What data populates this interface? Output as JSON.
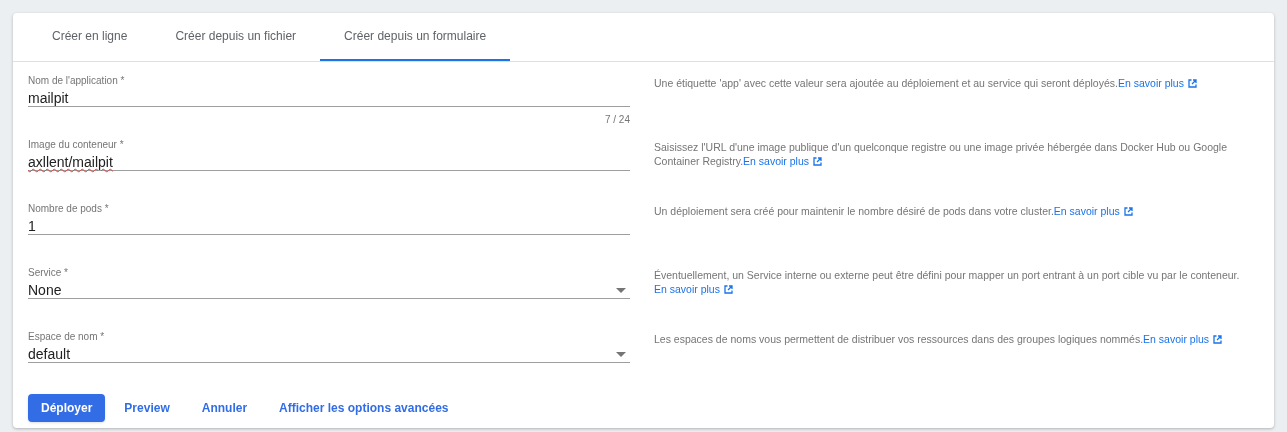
{
  "tabs": [
    {
      "label": "Créer en ligne",
      "selected": false
    },
    {
      "label": "Créer depuis un fichier",
      "selected": false
    },
    {
      "label": "Créer depuis un formulaire",
      "selected": true
    }
  ],
  "fields": [
    {
      "kind": "text",
      "label": "Nom de l'application *",
      "value": "mailpit",
      "counter": "7 / 24",
      "misspelled": false,
      "help": "Une étiquette 'app' avec cette valeur sera ajoutée au déploiement et au service qui seront déployés.",
      "link": "En savoir plus"
    },
    {
      "kind": "text",
      "label": "Image du conteneur *",
      "value": "axllent/mailpit",
      "misspelled": true,
      "help": "Saisissez l'URL d'une image publique d'un quelconque registre ou une image privée hébergée dans Docker Hub ou Google Container Registry.",
      "link": "En savoir plus"
    },
    {
      "kind": "text",
      "label": "Nombre de pods *",
      "value": "1",
      "misspelled": false,
      "help": "Un déploiement sera créé pour maintenir le nombre désiré de pods dans votre cluster.",
      "link": "En savoir plus"
    },
    {
      "kind": "select",
      "label": "Service *",
      "value": "None",
      "misspelled": false,
      "help": "Éventuellement, un Service interne ou externe peut être défini pour mapper un port entrant à un port cible vu par le conteneur.",
      "link": "En savoir plus"
    },
    {
      "kind": "select",
      "label": "Espace de nom *",
      "value": "default",
      "misspelled": false,
      "help": "Les espaces de noms vous permettent de distribuer vos ressources dans des groupes logiques nommés.",
      "link": "En savoir plus"
    }
  ],
  "actions": [
    {
      "kind": "primary",
      "label": "Déployer"
    },
    {
      "kind": "link",
      "label": "Preview"
    },
    {
      "kind": "link",
      "label": "Annuler"
    },
    {
      "kind": "link",
      "label": "Afficher les options avancées"
    }
  ]
}
